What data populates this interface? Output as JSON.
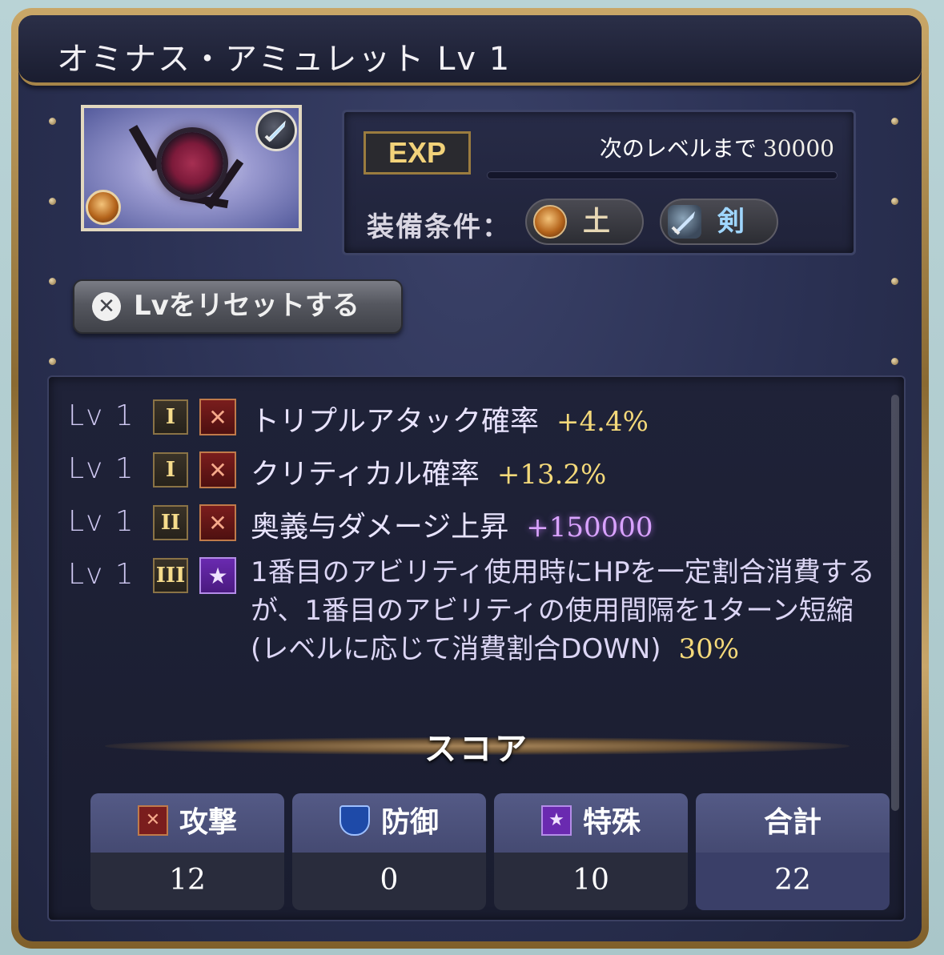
{
  "title": "オミナス・アミュレット Lv 1",
  "info": {
    "exp_label": "EXP",
    "next_level_label": "次のレベルまで",
    "next_level_value": "30000",
    "exp_progress": 0,
    "equip_label": "装備条件：",
    "equip_element": "土",
    "equip_weapon": "剣"
  },
  "reset_button": "Lvをリセットする",
  "skills": [
    {
      "lv": "Lv 1",
      "rank": "I",
      "type": "attack",
      "name": "トリプルアタック確率",
      "value": "+4.4%"
    },
    {
      "lv": "Lv 1",
      "rank": "I",
      "type": "attack",
      "name": "クリティカル確率",
      "value": "+13.2%"
    },
    {
      "lv": "Lv 1",
      "rank": "II",
      "type": "attack",
      "name": "奥義与ダメージ上昇",
      "value": "+150000"
    },
    {
      "lv": "Lv 1",
      "rank": "III",
      "type": "special",
      "desc": "1番目のアビリティ使用時にHPを一定割合消費するが、1番目のアビリティの使用間隔を1ターン短縮(レベルに応じて消費割合DOWN)",
      "value": "30%"
    }
  ],
  "score": {
    "title": "スコア",
    "headers": {
      "attack": "攻撃",
      "defense": "防御",
      "special": "特殊",
      "total": "合計"
    },
    "values": {
      "attack": "12",
      "defense": "0",
      "special": "10",
      "total": "22"
    }
  },
  "colors": {
    "gold": "#f4d97a",
    "purple": "#d9a2ff",
    "frame": "#a68549",
    "panel": "#2a3052"
  },
  "icons": {
    "attack": "crossed-swords-icon",
    "special": "star-icon",
    "defense": "shield-icon",
    "element": "earth-element-icon",
    "weapon": "sword-icon"
  }
}
